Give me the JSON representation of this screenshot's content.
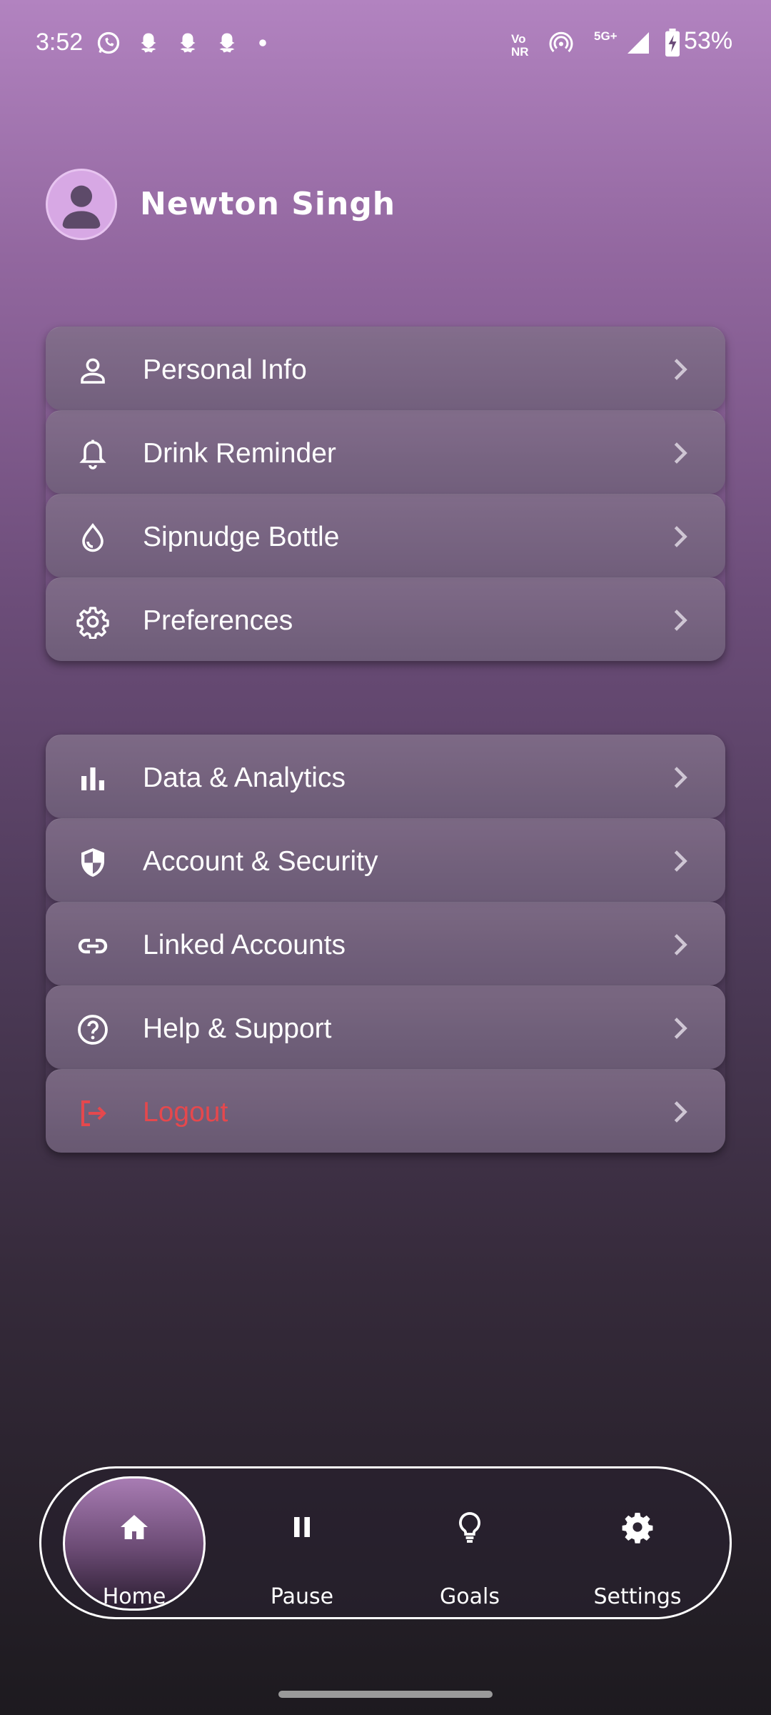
{
  "status_bar": {
    "time": "3:52",
    "network_vo": "Vo",
    "network_nr": "NR",
    "network_5g": "5G+",
    "battery_percent": "53%"
  },
  "profile": {
    "name": "Newton Singh"
  },
  "menu": {
    "group1": [
      {
        "label": "Personal Info",
        "icon": "person-icon"
      },
      {
        "label": "Drink Reminder",
        "icon": "bell-icon"
      },
      {
        "label": "Sipnudge Bottle",
        "icon": "water-drop-icon"
      },
      {
        "label": "Preferences",
        "icon": "gear-icon"
      }
    ],
    "group2": [
      {
        "label": "Data & Analytics",
        "icon": "bar-chart-icon"
      },
      {
        "label": "Account & Security",
        "icon": "shield-icon"
      },
      {
        "label": "Linked Accounts",
        "icon": "link-icon"
      },
      {
        "label": "Help & Support",
        "icon": "help-circle-icon"
      },
      {
        "label": "Logout",
        "icon": "logout-icon",
        "color": "#e5484d"
      }
    ]
  },
  "bottom_nav": {
    "items": [
      {
        "label": "Home",
        "icon": "home-icon",
        "active": true
      },
      {
        "label": "Pause",
        "icon": "pause-icon"
      },
      {
        "label": "Goals",
        "icon": "lightbulb-icon"
      },
      {
        "label": "Settings",
        "icon": "gear-icon"
      }
    ]
  },
  "colors": {
    "danger": "#e5484d",
    "gradient_top": "#b283c0",
    "gradient_bottom": "#1d1a1f"
  }
}
